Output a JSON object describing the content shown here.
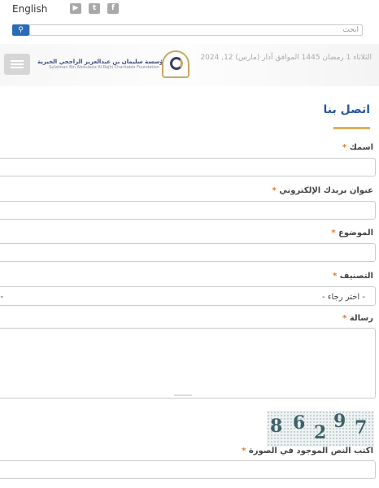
{
  "topbar": {
    "language": "English",
    "social": [
      {
        "name": "youtube-icon",
        "glyph": "▶"
      },
      {
        "name": "twitter-icon",
        "glyph": "t"
      },
      {
        "name": "facebook-icon",
        "glyph": "f"
      }
    ]
  },
  "search": {
    "placeholder": "ابحث",
    "icon": "search-icon"
  },
  "header": {
    "logo_ar": "مؤسسة سليمان بن عبدالعزيز الراجحي الخيرية",
    "logo_en": "Sulaiman Bin Abdulaziz Al Rajhi Charitable Foundation",
    "date": "الثلاثاء 1 رمضان 1445 الموافق آذار (مارس) 12, 2024"
  },
  "page": {
    "title": "اتصل بنا"
  },
  "form": {
    "name_label": "اسمك",
    "email_label": "عنوان بريدك الإلكتروني",
    "subject_label": "الموضوع",
    "category_label": "التصنيف",
    "category_selected": "- اختر رجاء -",
    "message_label": "رسالة",
    "captcha_label": "اكتب النص الموجود في الصورة",
    "captcha_chars": [
      "8",
      "6",
      "2",
      "9",
      "7"
    ],
    "required_mark": "*"
  },
  "colors": {
    "accent": "#2a5aa0",
    "gold": "#d8b35a",
    "required": "#e07b2e"
  }
}
